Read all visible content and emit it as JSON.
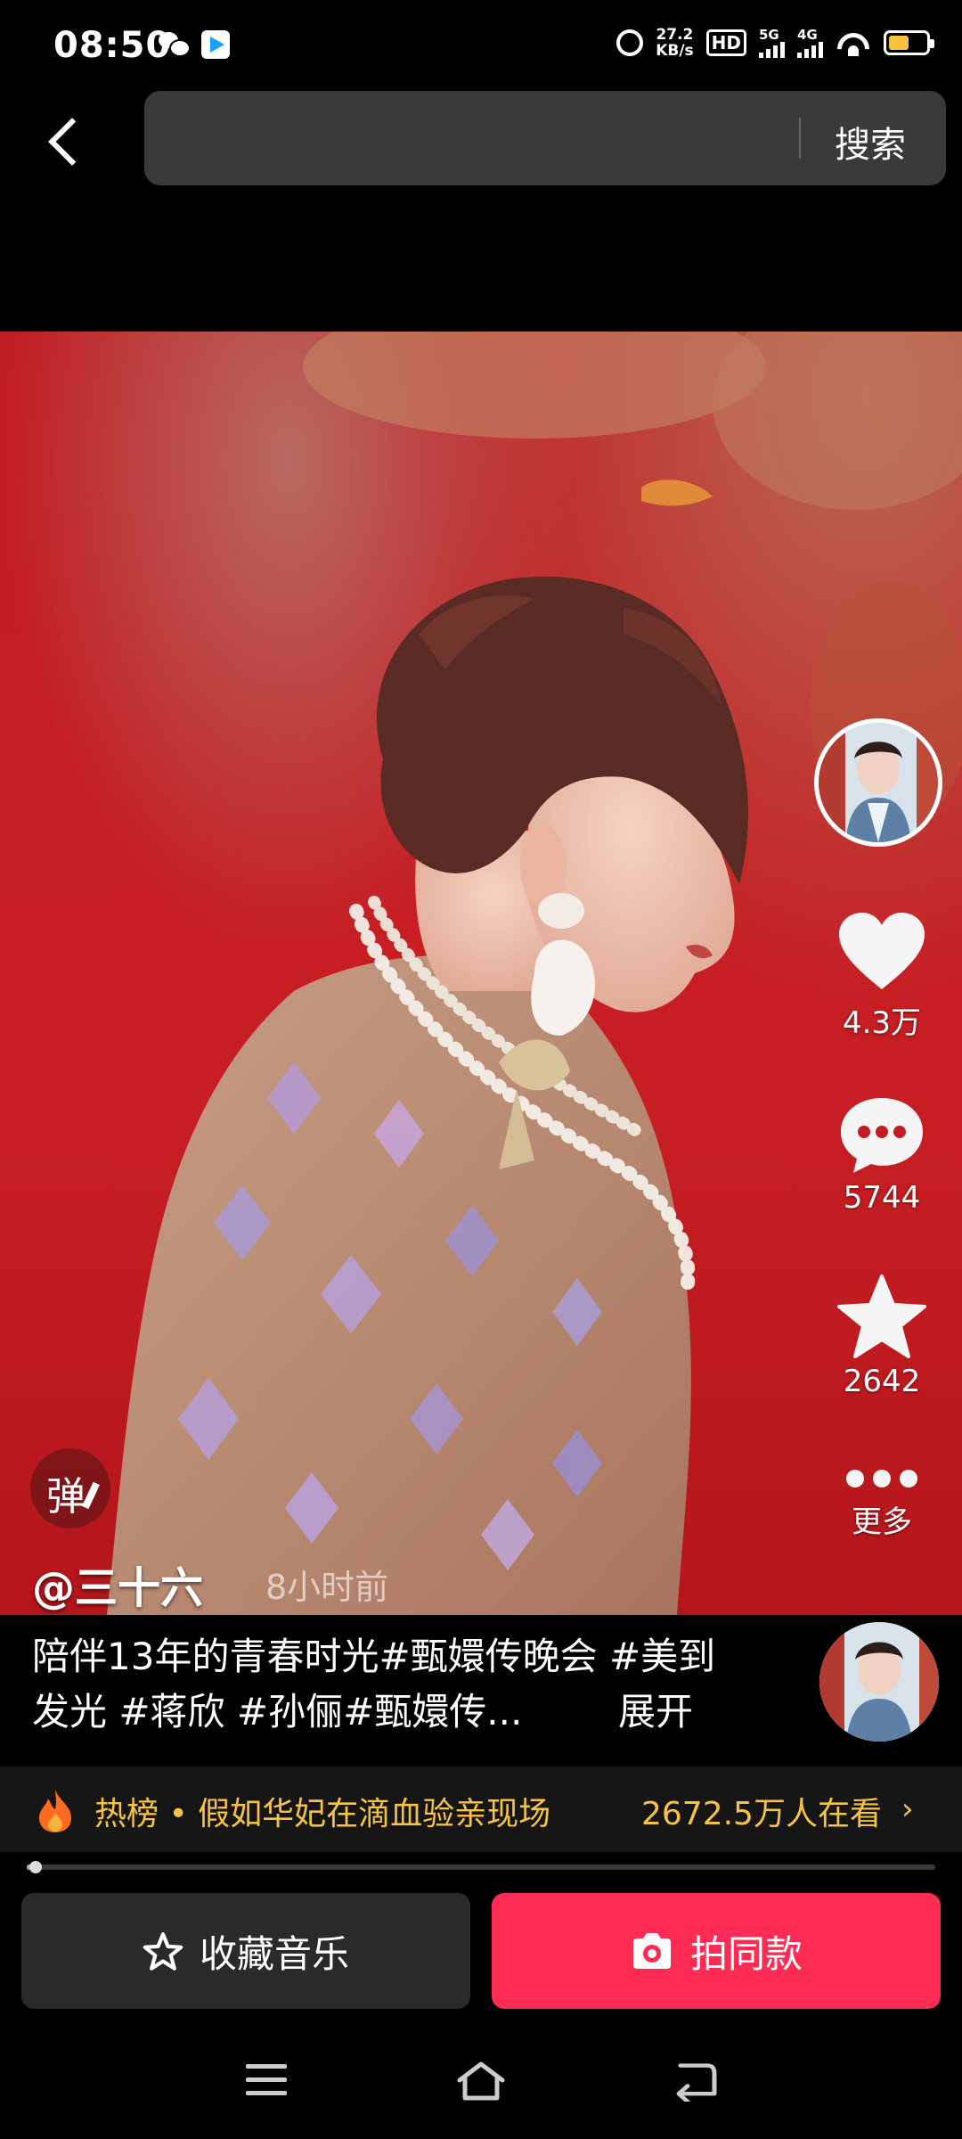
{
  "status_bar": {
    "time": "08:50",
    "net_speed_value": "27.2",
    "net_speed_unit": "KB/s",
    "hd_label": "HD",
    "sim1_label": "5G",
    "sim2_label": "4G",
    "battery_level": 0.55,
    "battery_color": "#f5c33b"
  },
  "top_bar": {
    "search_placeholder": "",
    "search_label": "搜索"
  },
  "video": {
    "author": "@三十六",
    "post_time": "8小时前",
    "danmu_label": "弹",
    "likes": "4.3万",
    "comments": "5744",
    "favorites": "2642",
    "more_label": "更多"
  },
  "caption": {
    "text": "陪伴13年的青春时光#甄嬛传晚会 #美到发光 #蒋欣 #孙俪#甄嬛传...",
    "expand_label": "展开"
  },
  "hot_list": {
    "text": "热榜 • 假如华妃在滴血验亲现场",
    "viewers": "2672.5万人在看",
    "accent_color": "#f6c344",
    "playback_progress": 0.005
  },
  "actions": {
    "collect_music_label": "收藏音乐",
    "shoot_same_label": "拍同款",
    "shoot_color": "#fe2c55"
  }
}
